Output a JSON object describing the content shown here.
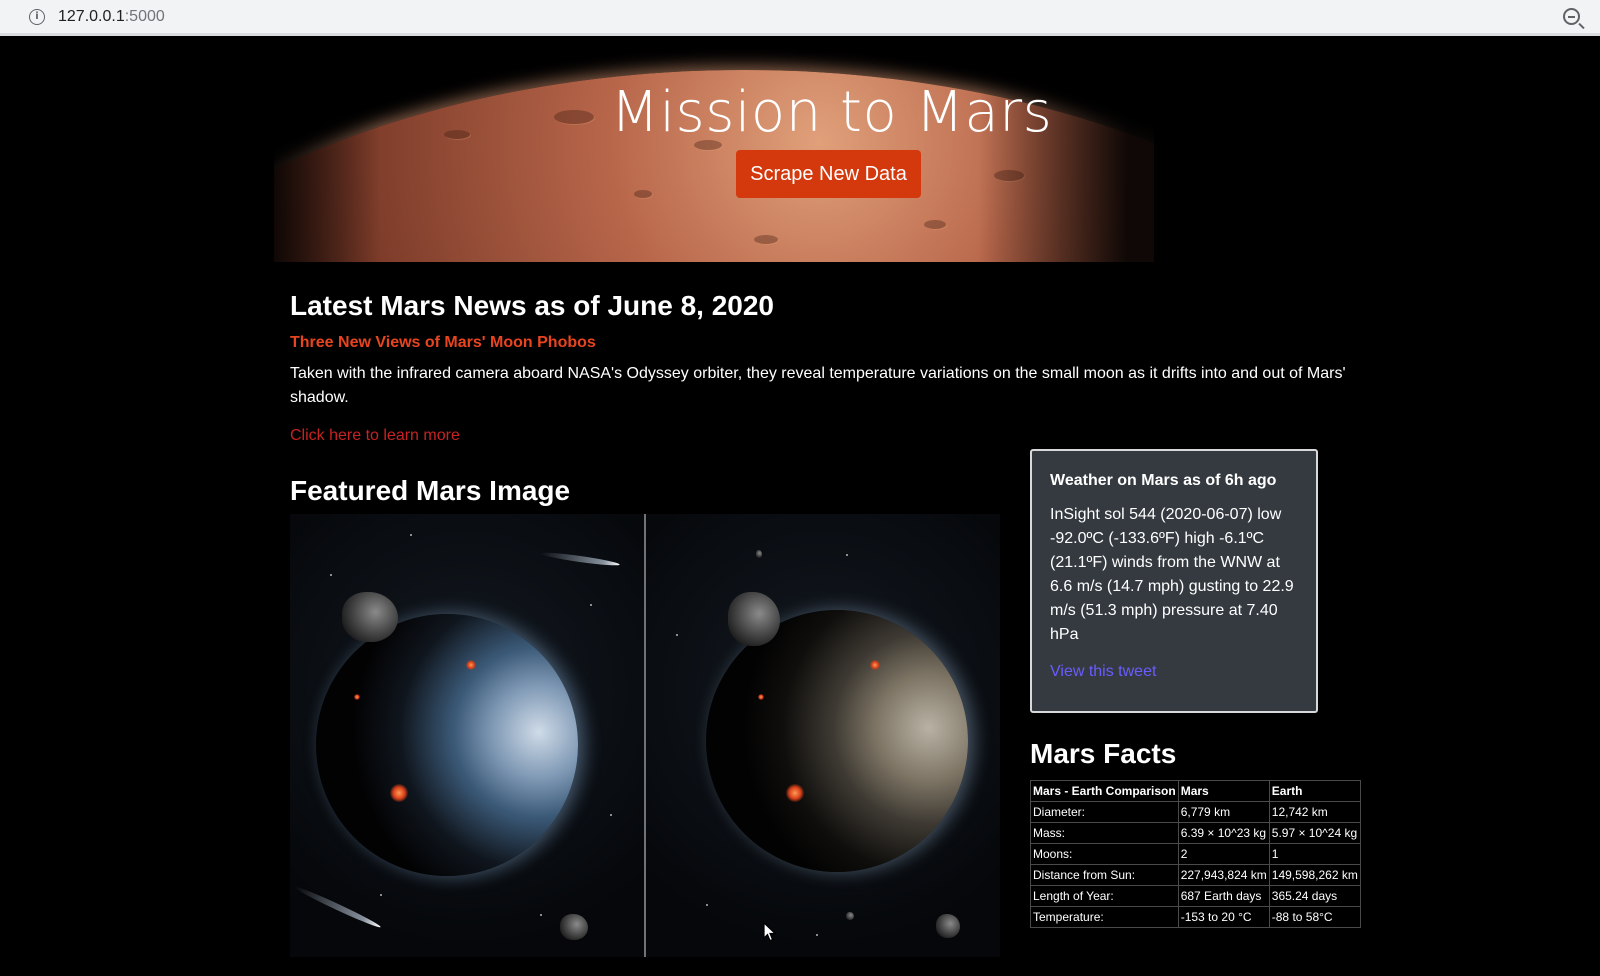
{
  "browser": {
    "url_host": "127.0.0.1",
    "url_port": ":5000"
  },
  "hero": {
    "title": "Mission to Mars",
    "button_label": "Scrape New Data"
  },
  "news": {
    "heading": "Latest Mars News as of June 8, 2020",
    "title": "Three New Views of Mars' Moon Phobos",
    "body": "Taken with the infrared camera aboard NASA's Odyssey orbiter, they reveal temperature variations on the small moon as it drifts into and out of Mars' shadow.",
    "link_text": "Click here to learn more"
  },
  "featured": {
    "heading": "Featured Mars Image"
  },
  "weather": {
    "title": "Weather on Mars as of 6h ago",
    "text": "InSight sol 544 (2020-06-07) low -92.0ºC (-133.6ºF) high -6.1ºC (21.1ºF) winds from the WNW at 6.6 m/s (14.7 mph) gusting to 22.9 m/s (51.3 mph) pressure at 7.40 hPa",
    "link_text": "View this tweet"
  },
  "facts": {
    "heading": "Mars Facts",
    "columns": [
      "Mars - Earth Comparison",
      "Mars",
      "Earth"
    ],
    "rows": [
      [
        "Diameter:",
        "6,779 km",
        "12,742 km"
      ],
      [
        "Mass:",
        "6.39 × 10^23 kg",
        "5.97 × 10^24 kg"
      ],
      [
        "Moons:",
        "2",
        "1"
      ],
      [
        "Distance from Sun:",
        "227,943,824 km",
        "149,598,262 km"
      ],
      [
        "Length of Year:",
        "687 Earth days",
        "365.24 days"
      ],
      [
        "Temperature:",
        "-153 to 20 °C",
        "-88 to 58°C"
      ]
    ]
  },
  "colors": {
    "button": "#d4380d",
    "news_title": "#e8441f",
    "learn_more": "#c82222",
    "tweet_link": "#6a5cff",
    "card_bg": "#343a40"
  },
  "icons": [
    "info-icon",
    "zoom-icon",
    "mouse-cursor-icon"
  ]
}
